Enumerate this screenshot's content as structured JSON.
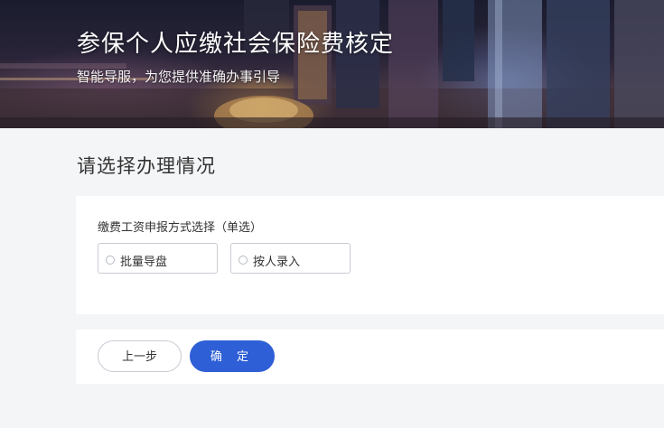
{
  "banner": {
    "title": "参保个人应缴社会保险费核定",
    "subtitle": "智能导服，为您提供准确办事引导"
  },
  "section": {
    "title": "请选择办理情况"
  },
  "form": {
    "label": "缴费工资申报方式选择（单选）",
    "options": [
      {
        "label": "批量导盘",
        "checked": false
      },
      {
        "label": "按人录入",
        "checked": false
      }
    ]
  },
  "actions": {
    "prev_label": "上一步",
    "confirm_label": "确 定"
  },
  "colors": {
    "primary": "#2e5fd6",
    "page_bg": "#f4f5f7",
    "card_bg": "#ffffff"
  }
}
